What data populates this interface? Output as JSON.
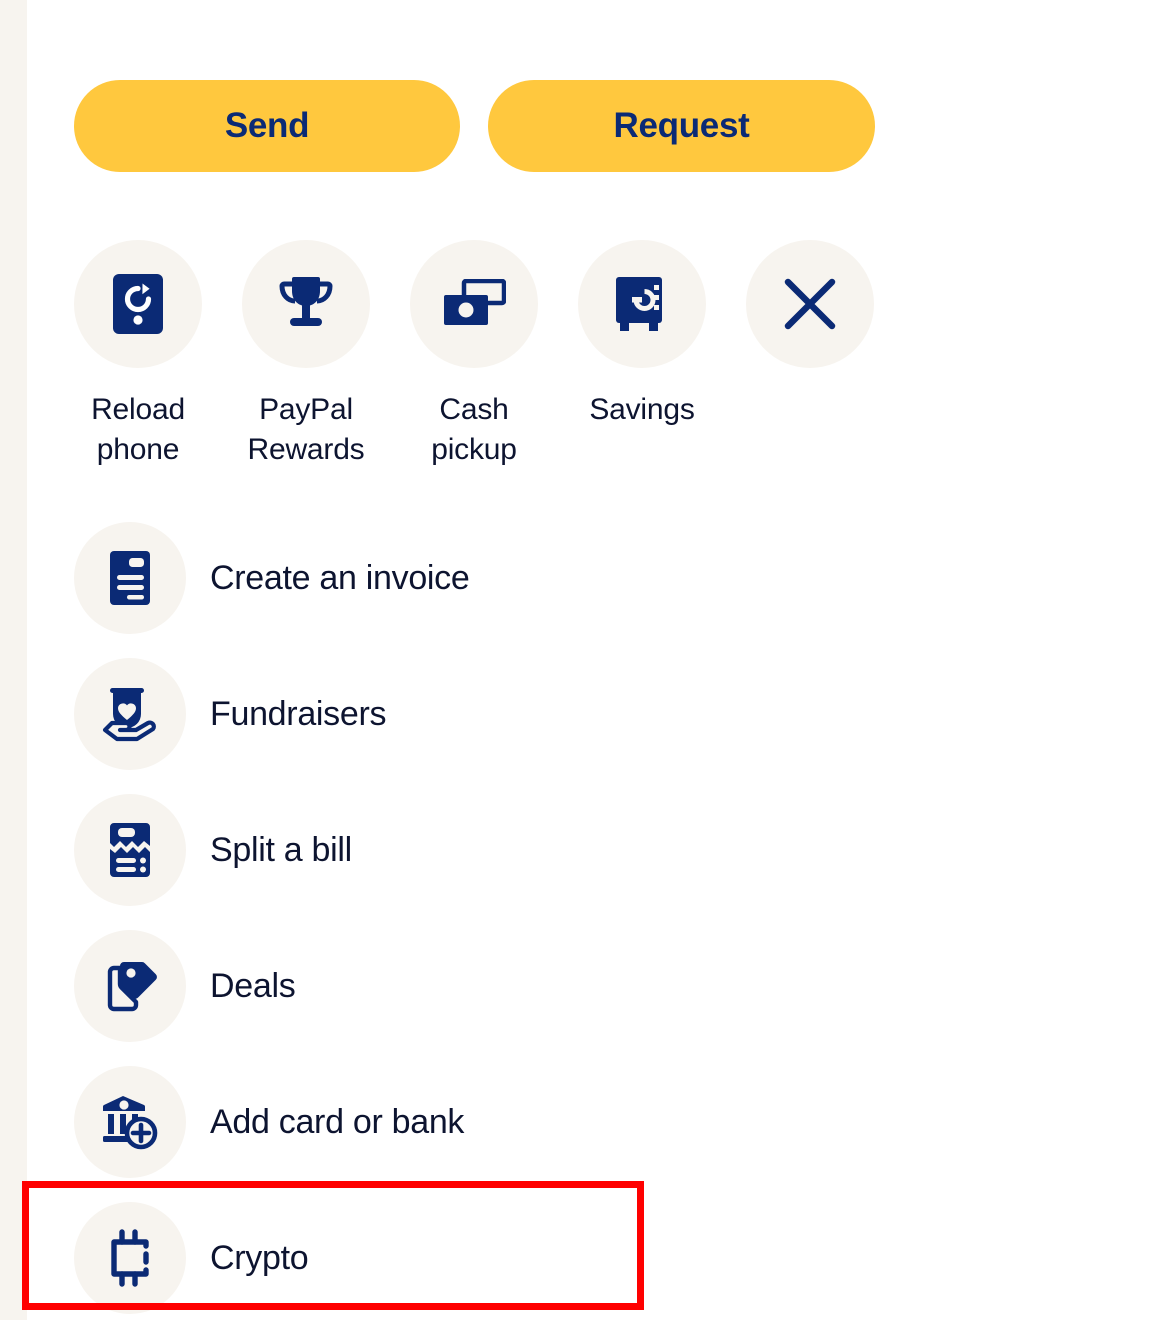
{
  "theme": {
    "accent_yellow": "#FFC83E",
    "brand_navy": "#0B2A75",
    "text_navy": "#0D1430",
    "circle_bg": "#F7F4EF",
    "highlight_red": "#FF0000"
  },
  "primary_actions": {
    "send_label": "Send",
    "request_label": "Request"
  },
  "quick_actions": [
    {
      "label": "Reload phone",
      "icon": "reload-phone-icon"
    },
    {
      "label": "PayPal Rewards",
      "icon": "trophy-icon"
    },
    {
      "label": "Cash pickup",
      "icon": "cash-icon"
    },
    {
      "label": "Savings",
      "icon": "safe-icon"
    },
    {
      "label": "",
      "icon": "close-icon"
    }
  ],
  "action_list": [
    {
      "label": "Create an invoice",
      "icon": "invoice-icon"
    },
    {
      "label": "Fundraisers",
      "icon": "hand-heart-icon"
    },
    {
      "label": "Split a bill",
      "icon": "torn-receipt-icon"
    },
    {
      "label": "Deals",
      "icon": "price-tag-icon"
    },
    {
      "label": "Add card or bank",
      "icon": "bank-plus-icon"
    },
    {
      "label": "Crypto",
      "icon": "chip-icon"
    }
  ],
  "highlight": {
    "target": "Crypto",
    "color": "#FF0000"
  }
}
